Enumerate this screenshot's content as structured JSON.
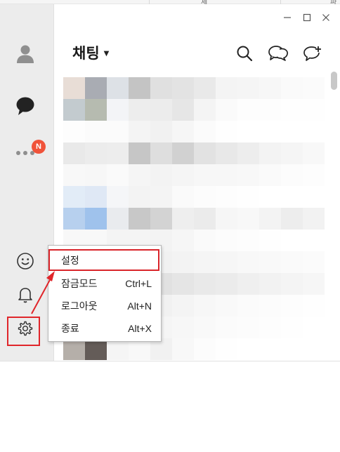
{
  "background_window": {
    "fragment_left": "제",
    "fragment_right": "파"
  },
  "window": {
    "title": "채팅",
    "controls": [
      "minimize-icon",
      "maximize-icon",
      "close-icon"
    ]
  },
  "sidebar": {
    "items": [
      {
        "name": "friends",
        "icon": "person-icon"
      },
      {
        "name": "chats",
        "icon": "chat-bubble-icon"
      },
      {
        "name": "more",
        "icon": "more-dots-icon",
        "badge": "N"
      },
      {
        "name": "emoticon",
        "icon": "smiley-icon"
      },
      {
        "name": "notifications",
        "icon": "bell-icon"
      },
      {
        "name": "settings",
        "icon": "gear-icon"
      }
    ]
  },
  "header_actions": [
    "search-icon",
    "open-chat-icon",
    "new-chat-icon"
  ],
  "context_menu": {
    "items": [
      {
        "label": "설정",
        "shortcut": ""
      },
      {
        "label": "잠금모드",
        "shortcut": "Ctrl+L"
      },
      {
        "label": "로그아웃",
        "shortcut": "Alt+N"
      },
      {
        "label": "종료",
        "shortcut": "Alt+X"
      }
    ]
  },
  "colors": {
    "badge": "#f0533a",
    "highlight_box": "#d9242a",
    "arrow": "#e0262b",
    "sidebar_bg": "#ececec"
  }
}
